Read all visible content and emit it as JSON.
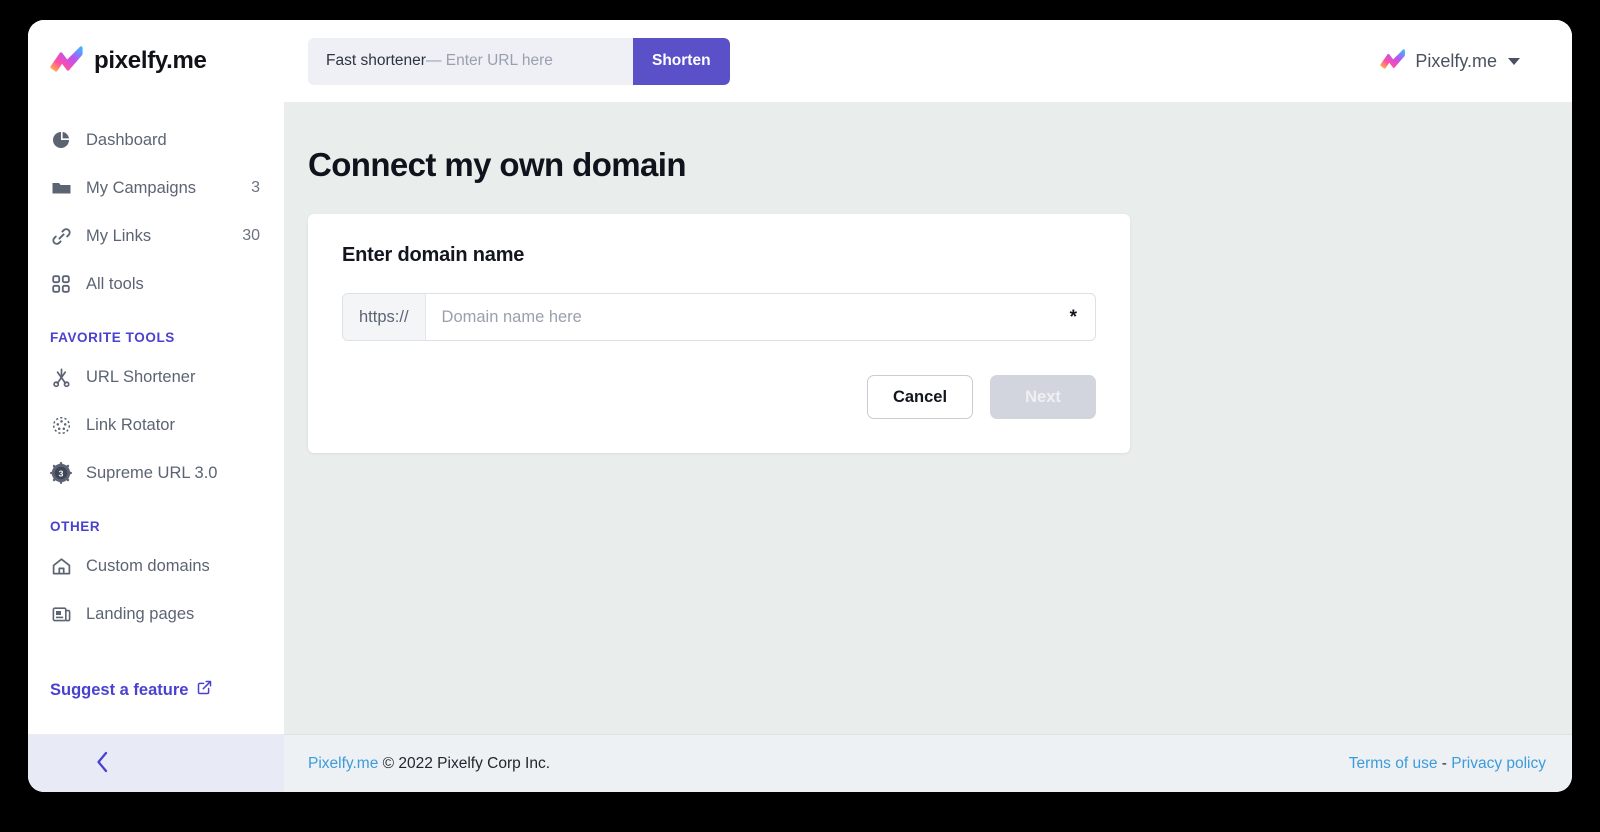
{
  "app": {
    "brand_name": "pixelfy.me",
    "brand_icon": "pixelfy-bolt-logo"
  },
  "topbar": {
    "shortener": {
      "label": "Fast shortener",
      "placeholder": "— Enter URL here",
      "value": "",
      "button_label": "Shorten"
    },
    "account": {
      "name": "Pixelfy.me",
      "avatar_icon": "pixelfy-bolt-logo",
      "caret_icon": "chevron-down-icon"
    }
  },
  "sidebar": {
    "items": [
      {
        "label": "Dashboard",
        "icon": "pie-chart-icon",
        "count": ""
      },
      {
        "label": "My Campaigns",
        "icon": "folder-icon",
        "count": "3"
      },
      {
        "label": "My Links",
        "icon": "link-icon",
        "count": "30"
      },
      {
        "label": "All tools",
        "icon": "grid-icon",
        "count": ""
      }
    ],
    "favorite_tools_title": "FAVORITE TOOLS",
    "favorite_tools": [
      {
        "label": "URL Shortener",
        "icon": "scissors-icon"
      },
      {
        "label": "Link Rotator",
        "icon": "rotator-circle-icon"
      },
      {
        "label": "Supreme URL 3.0",
        "icon": "gear-badge-3-icon"
      }
    ],
    "other_title": "OTHER",
    "other_items": [
      {
        "label": "Custom domains",
        "icon": "home-icon"
      },
      {
        "label": "Landing pages",
        "icon": "pages-icon"
      }
    ],
    "suggest": {
      "label": "Suggest a feature",
      "icon": "external-link-icon"
    },
    "collapse_icon": "chevron-left-icon"
  },
  "main": {
    "page_title": "Connect my own domain",
    "card": {
      "label": "Enter domain name",
      "input_prefix": "https://",
      "input_placeholder": "Domain name here",
      "input_value": "",
      "required_marker": "*",
      "cancel_label": "Cancel",
      "next_label": "Next"
    }
  },
  "footer": {
    "brand_link": "Pixelfy.me",
    "copyright": "© 2022 Pixelfy Corp Inc.",
    "terms_label": "Terms of use",
    "separator": "-",
    "privacy_label": "Privacy policy"
  },
  "colors": {
    "accent_purple": "#5a51c8",
    "section_heading": "#4b41d1",
    "link_blue": "#3c9bdb",
    "main_bg": "#e9edec",
    "disabled_button": "#d2d5dd"
  }
}
